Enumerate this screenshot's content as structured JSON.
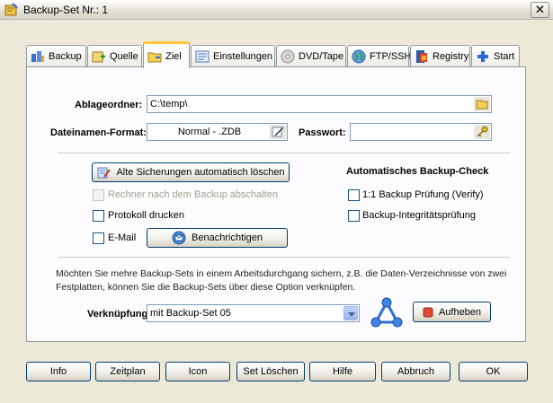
{
  "window": {
    "title": "Backup-Set Nr.: 1",
    "close_glyph": "✕"
  },
  "tabs": [
    {
      "label": "Backup",
      "icon": "backup-icon",
      "active": false
    },
    {
      "label": "Quelle",
      "icon": "source-icon",
      "active": false
    },
    {
      "label": "Ziel",
      "icon": "folder-icon",
      "active": true
    },
    {
      "label": "Einstellungen",
      "icon": "settings-icon",
      "active": false
    },
    {
      "label": "DVD/Tape",
      "icon": "disc-icon",
      "active": false
    },
    {
      "label": "FTP/SSH",
      "icon": "globe-icon",
      "active": false
    },
    {
      "label": "Registry",
      "icon": "registry-icon",
      "active": false
    },
    {
      "label": "Start",
      "icon": "plus-icon",
      "active": false
    }
  ],
  "target": {
    "folder_label": "Ablageordner:",
    "folder_value": "C:\\temp\\",
    "filename_label": "Dateinamen-Format:",
    "filename_value": "Normal - .ZDB",
    "password_label": "Passwort:",
    "password_value": ""
  },
  "options": {
    "delete_old_button": "Alte Sicherungen automatisch löschen",
    "shutdown_label": "Rechner nach dem Backup abschalten",
    "print_log_label": "Protokoll drucken",
    "email_label": "E-Mail",
    "notify_button": "Benachrichtigen"
  },
  "auto_check": {
    "heading": "Automatisches Backup-Check",
    "verify_label": "1:1 Backup Prüfung (Verify)",
    "integrity_label": "Backup-Integritätsprüfung"
  },
  "link": {
    "info_text": "Möchten Sie mehre Backup-Sets in einem Arbeitsdurchgang sichern, z.B. die Daten-Verzeichnisse von zwei Festplatten, können Sie die Backup-Sets über diese Option verknüpfen.",
    "label": "Verknüpfung mit:",
    "selected": "mit Backup-Set 05",
    "cancel_button": "Aufheben"
  },
  "bottom_buttons": [
    {
      "name": "info-button",
      "label": "Info"
    },
    {
      "name": "schedule-button",
      "label": "Zeitplan"
    },
    {
      "name": "icon-button",
      "label": "Icon"
    },
    {
      "name": "delete-set-button",
      "label": "Set Löschen"
    },
    {
      "name": "help-button",
      "label": "Hilfe"
    },
    {
      "name": "cancel-button",
      "label": "Abbruch"
    },
    {
      "name": "ok-button",
      "label": "OK"
    }
  ],
  "colors": {
    "accent_tab": "#ffc83c",
    "window_bg": "#ece9d8",
    "panel_bg": "#fcfcfe",
    "field_border": "#7f9db9"
  }
}
